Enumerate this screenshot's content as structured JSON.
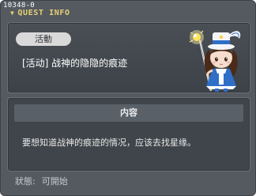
{
  "window": {
    "id": "10348-0",
    "title": "QUEST INFO"
  },
  "quest": {
    "category": "活動",
    "name": "[活动] 战神的隐隐的痕迹"
  },
  "info": {
    "header": "内容",
    "text": "要想知道战神的痕迹的情况，应该去找星缘。"
  },
  "status": {
    "label": "狀態:",
    "value": "可開始"
  },
  "colors": {
    "title": "#e6cf74",
    "panel": "#40454b",
    "window": "#555a61"
  },
  "icons": {
    "npc": "npc-character-illustration"
  }
}
